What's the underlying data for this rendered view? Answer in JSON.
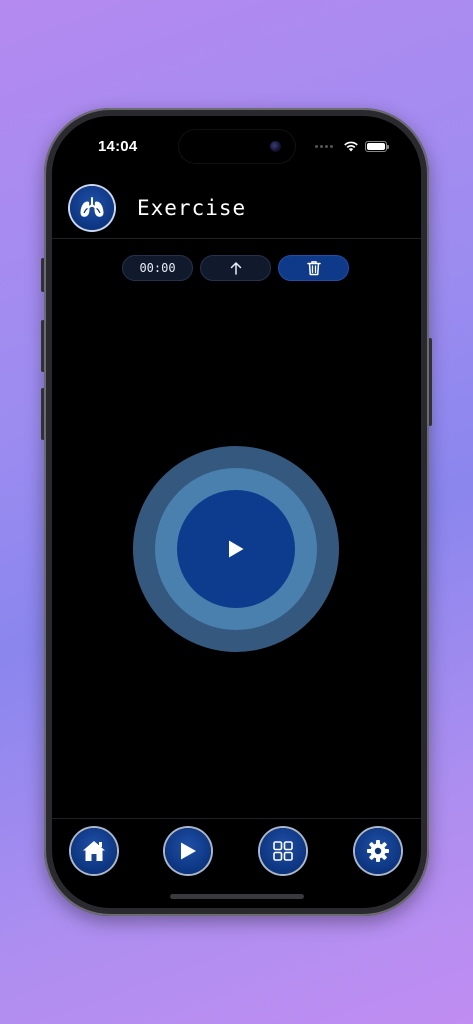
{
  "status_bar": {
    "time": "14:04",
    "icons": [
      "cellular-dots-icon",
      "wifi-icon",
      "battery-icon"
    ]
  },
  "header": {
    "title": "Exercise",
    "logo_icon": "lungs-icon"
  },
  "toolbar": {
    "timer": "00:00",
    "upload_icon": "arrow-up-icon",
    "delete_icon": "trash-icon"
  },
  "main": {
    "play_icon": "play-icon"
  },
  "bottom_nav": {
    "items": [
      {
        "icon": "home-icon"
      },
      {
        "icon": "play-icon"
      },
      {
        "icon": "grid-icon"
      },
      {
        "icon": "gear-icon"
      }
    ]
  },
  "colors": {
    "accent": "#0d3c8f",
    "ring_mid": "#4a80ad",
    "ring_outer": "#34587e",
    "background": "#000000"
  }
}
